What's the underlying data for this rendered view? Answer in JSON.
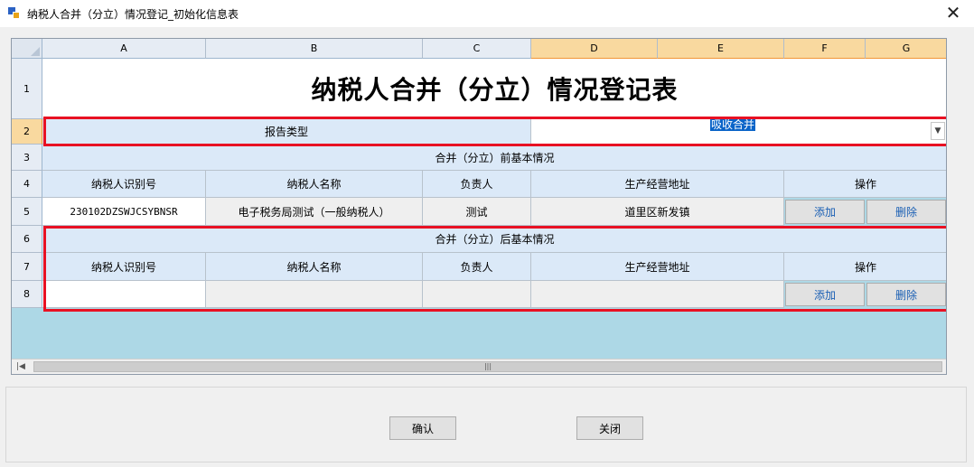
{
  "window": {
    "title": "纳税人合并（分立）情况登记_初始化信息表",
    "close_glyph": "✕"
  },
  "sheet": {
    "columns": [
      "A",
      "B",
      "C",
      "D",
      "E",
      "F",
      "G"
    ],
    "rows": [
      "1",
      "2",
      "3",
      "4",
      "5",
      "6",
      "7",
      "8"
    ],
    "title": "纳税人合并（分立）情况登记表",
    "report_type_label": "报告类型",
    "report_type_value": "吸收合并",
    "before_section": "合并（分立）前基本情况",
    "after_section": "合并（分立）后基本情况",
    "table_headers": [
      "纳税人识别号",
      "纳税人名称",
      "负责人",
      "生产经营地址",
      "操作"
    ],
    "before_row": {
      "taxpayer_id": "230102DZSWJCSYBNSR",
      "taxpayer_name": "电子税务局测试（一般纳税人）",
      "person": "测试",
      "address": "道里区新发镇"
    },
    "after_row": {
      "taxpayer_id": "",
      "taxpayer_name": "",
      "person": "",
      "address": ""
    },
    "add_label": "添加",
    "delete_label": "删除"
  },
  "buttons": {
    "confirm": "确认",
    "close": "关闭"
  },
  "colors": {
    "highlight": "#e81123",
    "header_bg": "#dbe9f8",
    "selected_header": "#f9d99f",
    "link": "#1a5fb4"
  }
}
